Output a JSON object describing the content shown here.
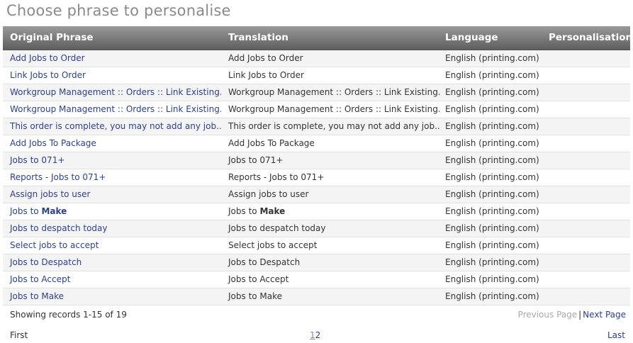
{
  "page": {
    "title": "Choose phrase to personalise"
  },
  "table": {
    "headers": {
      "original": "Original Phrase",
      "translation": "Translation",
      "language": "Language",
      "personalisation": "Personalisation"
    },
    "rows": [
      {
        "original": "Add Jobs to Order",
        "translation": "Add Jobs to Order",
        "language": "English (printing.com)",
        "personalisation": ""
      },
      {
        "original": "Link Jobs to Order",
        "translation": "Link Jobs to Order",
        "language": "English (printing.com)",
        "personalisation": ""
      },
      {
        "original": "Workgroup Management :: Orders :: Link Existing...",
        "translation": "Workgroup Management :: Orders :: Link Existing...",
        "language": "English (printing.com)",
        "personalisation": ""
      },
      {
        "original": "Workgroup Management :: Orders :: Link Existing...",
        "translation": "Workgroup Management :: Orders :: Link Existing...",
        "language": "English (printing.com)",
        "personalisation": ""
      },
      {
        "original": "This order is complete, you may not add any job...",
        "translation": "This order is complete, you may not add any job...",
        "language": "English (printing.com)",
        "personalisation": ""
      },
      {
        "original": "Add Jobs To Package",
        "translation": "Add Jobs To Package",
        "language": "English (printing.com)",
        "personalisation": ""
      },
      {
        "original": "Jobs to 071+",
        "translation": "Jobs to 071+",
        "language": "English (printing.com)",
        "personalisation": ""
      },
      {
        "original": "Reports - Jobs to 071+",
        "translation": "Reports - Jobs to 071+",
        "language": "English (printing.com)",
        "personalisation": ""
      },
      {
        "original": "Assign jobs to user",
        "translation": "Assign jobs to user",
        "language": "English (printing.com)",
        "personalisation": ""
      },
      {
        "original": "Jobs to ",
        "original_bold": "Make",
        "translation": "Jobs to ",
        "translation_bold": "Make",
        "language": "English (printing.com)",
        "personalisation": ""
      },
      {
        "original": "Jobs to despatch today",
        "translation": "Jobs to despatch today",
        "language": "English (printing.com)",
        "personalisation": ""
      },
      {
        "original": "Select jobs to accept",
        "translation": "Select jobs to accept",
        "language": "English (printing.com)",
        "personalisation": ""
      },
      {
        "original": "Jobs to Despatch",
        "translation": "Jobs to Despatch",
        "language": "English (printing.com)",
        "personalisation": ""
      },
      {
        "original": "Jobs to Accept",
        "translation": "Jobs to Accept",
        "language": "English (printing.com)",
        "personalisation": ""
      },
      {
        "original": "Jobs to Make",
        "translation": "Jobs to Make",
        "language": "English (printing.com)",
        "personalisation": ""
      }
    ]
  },
  "pagination": {
    "showing": "Showing records 1-15 of 19",
    "previous": "Previous Page",
    "separator": "|",
    "next": "Next Page",
    "first": "First",
    "pages": [
      "1",
      "2"
    ],
    "last": "Last"
  },
  "colors": {
    "link": "#2c3f8f",
    "header_top": "#9a9a9a",
    "header_bottom": "#5e5e5e",
    "row_alt": "#f4f4f4",
    "title": "#8a8a8a"
  }
}
